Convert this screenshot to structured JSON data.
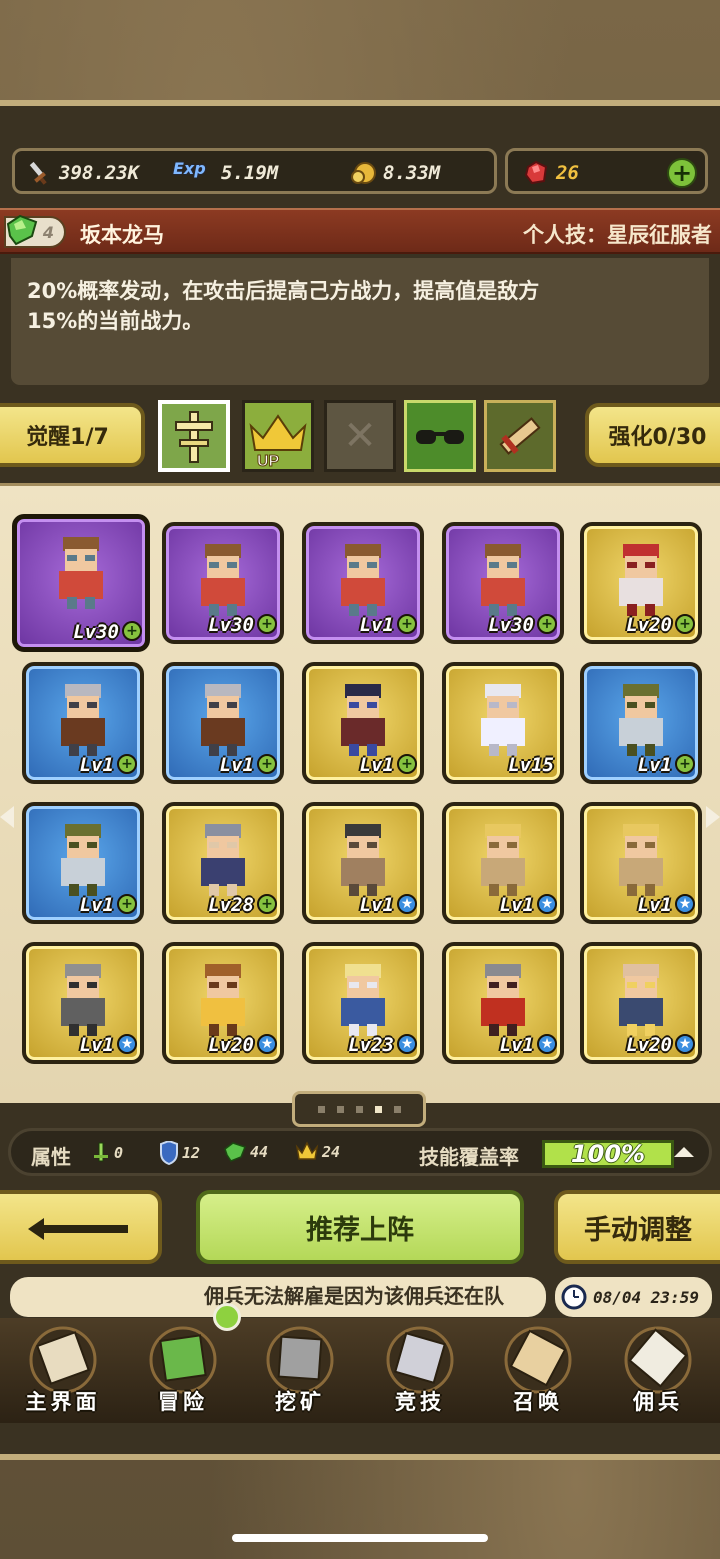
{
  "resources": {
    "power": "398.23K",
    "exp_tag": "Exp",
    "exp": "5.19M",
    "gold": "8.33M",
    "gems": "26",
    "add_label": "+"
  },
  "skill": {
    "awaken_tier": "4",
    "hero_name": "坂本龙马",
    "skill_name": "个人技：星辰征服者",
    "description_line1": "20%概率发动，在攻击后提高己方战力，提高值是敌方",
    "description_line2": "15%的当前战力。"
  },
  "awaken": {
    "left_label": "觉醒1/7",
    "right_label": "强化0/30",
    "up_tag": "UP"
  },
  "heroes": [
    {
      "rarity": "purple",
      "level": "Lv30",
      "btn": "+",
      "sprite": "goggles-hero"
    },
    {
      "rarity": "purple",
      "level": "Lv30",
      "btn": "+",
      "sprite": "goggles-hero"
    },
    {
      "rarity": "purple",
      "level": "Lv1",
      "btn": "+",
      "sprite": "goggles-hero"
    },
    {
      "rarity": "purple",
      "level": "Lv30",
      "btn": "+",
      "sprite": "goggles-hero"
    },
    {
      "rarity": "gold",
      "level": "Lv20",
      "btn": "+",
      "sprite": "headphone-girl"
    },
    {
      "rarity": "blue",
      "level": "Lv1",
      "btn": "+",
      "sprite": "armored-rider"
    },
    {
      "rarity": "blue",
      "level": "Lv1",
      "btn": "+",
      "sprite": "armored-rider"
    },
    {
      "rarity": "gold",
      "level": "Lv1",
      "btn": "+",
      "sprite": "dark-mage"
    },
    {
      "rarity": "gold",
      "level": "Lv15",
      "btn": "",
      "sprite": "teddy-bear"
    },
    {
      "rarity": "blue",
      "level": "Lv1",
      "btn": "+",
      "sprite": "hooded-ranger"
    },
    {
      "rarity": "blue",
      "level": "Lv1",
      "btn": "+",
      "sprite": "hooded-ranger"
    },
    {
      "rarity": "gold",
      "level": "Lv28",
      "btn": "+",
      "sprite": "silver-hair-man"
    },
    {
      "rarity": "gold",
      "level": "Lv1",
      "btn": "★",
      "sprite": "bearded-warrior"
    },
    {
      "rarity": "gold",
      "level": "Lv1",
      "btn": "★",
      "sprite": "blonde-knight"
    },
    {
      "rarity": "gold",
      "level": "Lv1",
      "btn": "★",
      "sprite": "blonde-knight"
    },
    {
      "rarity": "gold",
      "level": "Lv1",
      "btn": "★",
      "sprite": "iron-knight"
    },
    {
      "rarity": "gold",
      "level": "Lv20",
      "btn": "★",
      "sprite": "monkey-king"
    },
    {
      "rarity": "gold",
      "level": "Lv23",
      "btn": "★",
      "sprite": "saber-girl"
    },
    {
      "rarity": "gold",
      "level": "Lv1",
      "btn": "★",
      "sprite": "horned-warrior"
    },
    {
      "rarity": "gold",
      "level": "Lv20",
      "btn": "★",
      "sprite": "bald-elder"
    }
  ],
  "attributes": {
    "label": "属性",
    "sword": "0",
    "shield": "12",
    "gem": "44",
    "crown": "24",
    "coverage_label": "技能覆盖率",
    "coverage_value": "100%",
    "coverage_level": 1.0
  },
  "actions": {
    "recommend": "推荐上阵",
    "manual": "手动调整"
  },
  "ticker": {
    "text": "佣兵无法解雇是因为该佣兵还在队",
    "time": "08/04 23:59"
  },
  "nav": [
    {
      "label": "主界面",
      "icon": "map-scroll-icon"
    },
    {
      "label": "冒险",
      "icon": "island-icon"
    },
    {
      "label": "挖矿",
      "icon": "pickaxe-icon"
    },
    {
      "label": "竞技",
      "icon": "crossed-swords-icon"
    },
    {
      "label": "召唤",
      "icon": "summon-scroll-icon"
    },
    {
      "label": "佣兵",
      "icon": "tent-icon"
    }
  ],
  "colors": {
    "purple": "#7e44b4",
    "blue": "#3a78c4",
    "gold": "#d8b640",
    "accent_green": "#b1e14a"
  }
}
